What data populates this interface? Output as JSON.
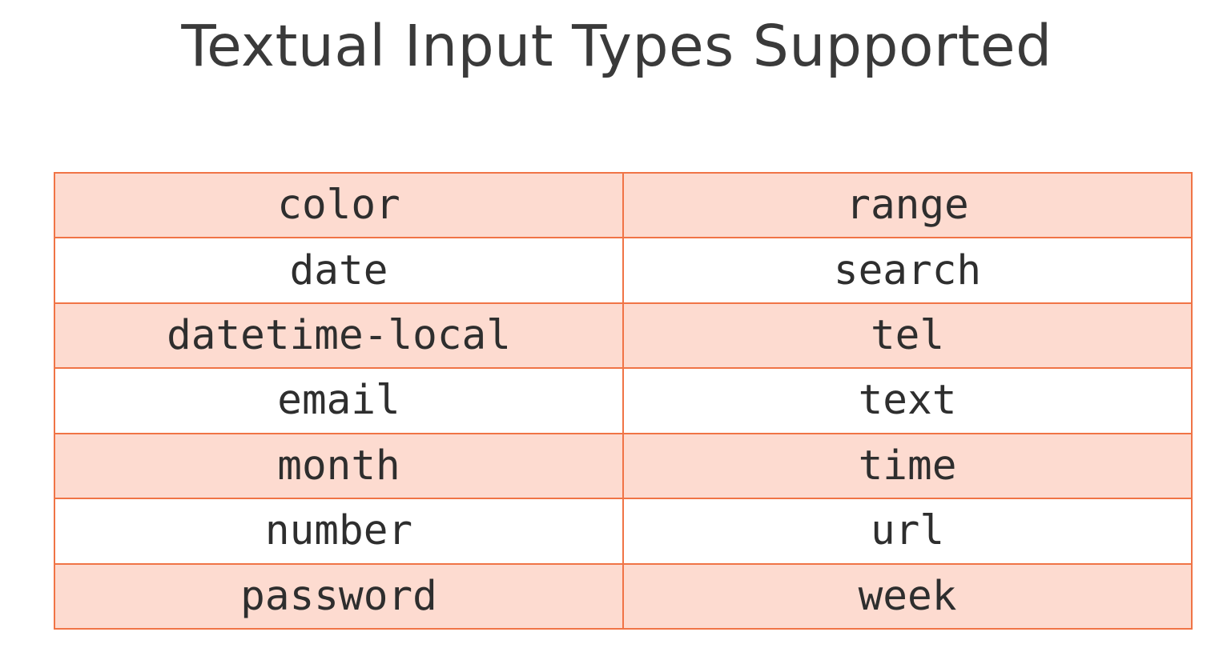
{
  "title": "Textual Input Types Supported",
  "colors": {
    "border": "#f07446",
    "shaded_row": "#fddbd0",
    "plain_row": "#ffffff",
    "text": "#2e2e2e"
  },
  "table": {
    "rows": [
      [
        "color",
        "range"
      ],
      [
        "date",
        "search"
      ],
      [
        "datetime-local",
        "tel"
      ],
      [
        "email",
        "text"
      ],
      [
        "month",
        "time"
      ],
      [
        "number",
        "url"
      ],
      [
        "password",
        "week"
      ]
    ]
  }
}
